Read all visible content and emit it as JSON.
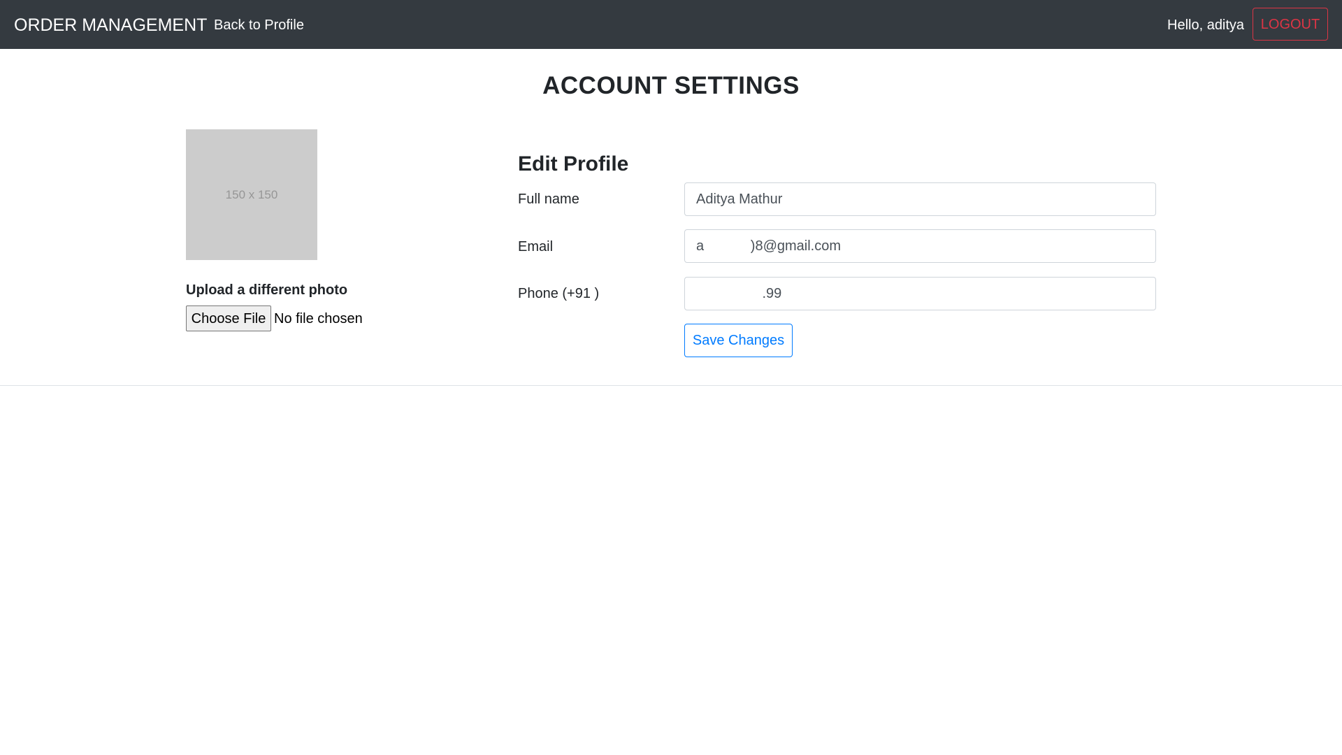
{
  "navbar": {
    "brand": "ORDER MANAGEMENT",
    "back_link": "Back to Profile",
    "greeting": "Hello, aditya",
    "logout_label": "LOGOUT"
  },
  "page": {
    "title": "ACCOUNT SETTINGS"
  },
  "photo": {
    "placeholder_text": "150 x 150",
    "upload_label": "Upload a different photo",
    "choose_file_label": "Choose File",
    "file_status": "No file chosen"
  },
  "profile_form": {
    "title": "Edit Profile",
    "full_name": {
      "label": "Full name",
      "value": "Aditya Mathur"
    },
    "email": {
      "label": "Email",
      "value": "a            )8@gmail.com"
    },
    "phone": {
      "label": "Phone (+91 )",
      "value": "                 .99"
    },
    "save_label": "Save Changes"
  },
  "colors": {
    "navbar_bg": "#343a40",
    "logout_red": "#dc3545",
    "primary_blue": "#007bff",
    "placeholder_gray": "#cccccc"
  }
}
